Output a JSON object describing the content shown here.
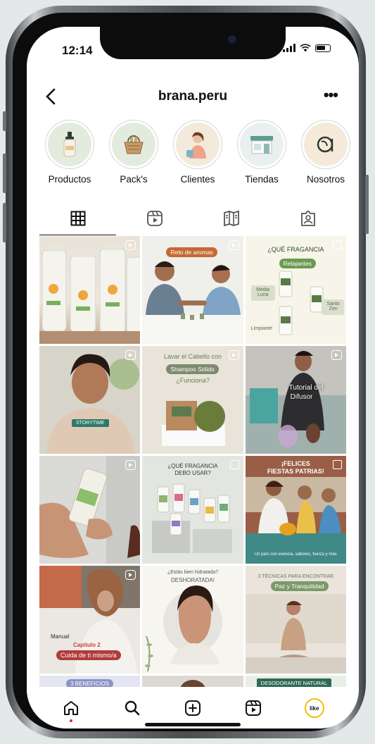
{
  "status_bar": {
    "time": "12:14"
  },
  "header": {
    "username": "brana.peru",
    "back_icon": "chevron-left-icon",
    "more_label": "•••"
  },
  "highlights": [
    {
      "label": "Productos",
      "icon": "bottle-icon"
    },
    {
      "label": "Pack's",
      "icon": "basket-icon"
    },
    {
      "label": "Clientes",
      "icon": "person-icon"
    },
    {
      "label": "Tiendas",
      "icon": "store-icon"
    },
    {
      "label": "Nosotros",
      "icon": "brand-logo-icon"
    }
  ],
  "tabs": [
    {
      "name": "posts-grid",
      "icon": "grid-icon"
    },
    {
      "name": "reels",
      "icon": "reels-icon"
    },
    {
      "name": "guides",
      "icon": "guide-icon"
    },
    {
      "name": "tagged",
      "icon": "tagged-icon"
    }
  ],
  "posts": {
    "p2_pill": "Reto de aromas",
    "p3_title": "¿QUÉ FRAGANCIA",
    "p3_pill": "Relajantes",
    "p3_left": "Media Luna",
    "p3_right": "Santo Zen",
    "p3_bottom": "Limpiante",
    "p4_tag": "STORYTIME",
    "p5_line1": "Lavar el Cabello con",
    "p5_pill": "Shampoo Sólido",
    "p5_line3": "¿Funciona?",
    "p6_line1": "Tutorial del",
    "p6_line2": "Difusor",
    "p8_line1": "¿QUÉ FRAGANCIA",
    "p8_line2": "DEBO USAR?",
    "p9_line1": "¡FELICES",
    "p9_line2": "FIESTAS PATRIAS!",
    "p9_caption": "Un país con esencia, sabores, fuerza y más",
    "p10_line1": "Manual",
    "p10_line2": "Capítulo 2",
    "p10_pill": "Cuida de ti mismo/a",
    "p11_line1": "¿Estás bien hidratada?",
    "p11_line2": "DESHORATADA!",
    "p12_line1": "3 TÉCNICAS PARA ENCONTRAR",
    "p12_pill": "Paz y Tranquilidad",
    "p13_pill": "3 BENEFICIOS",
    "p15_pill": "DESODORANTE NATURAL"
  },
  "bottom_nav": [
    {
      "name": "home",
      "icon": "home-icon"
    },
    {
      "name": "search",
      "icon": "search-icon"
    },
    {
      "name": "new-post",
      "icon": "add-icon"
    },
    {
      "name": "reels",
      "icon": "reels-icon"
    },
    {
      "name": "profile",
      "icon": "avatar",
      "label": "like"
    }
  ],
  "colors": {
    "accent_avatar_ring": "#f2c100",
    "notification_dot": "#e0243a"
  }
}
